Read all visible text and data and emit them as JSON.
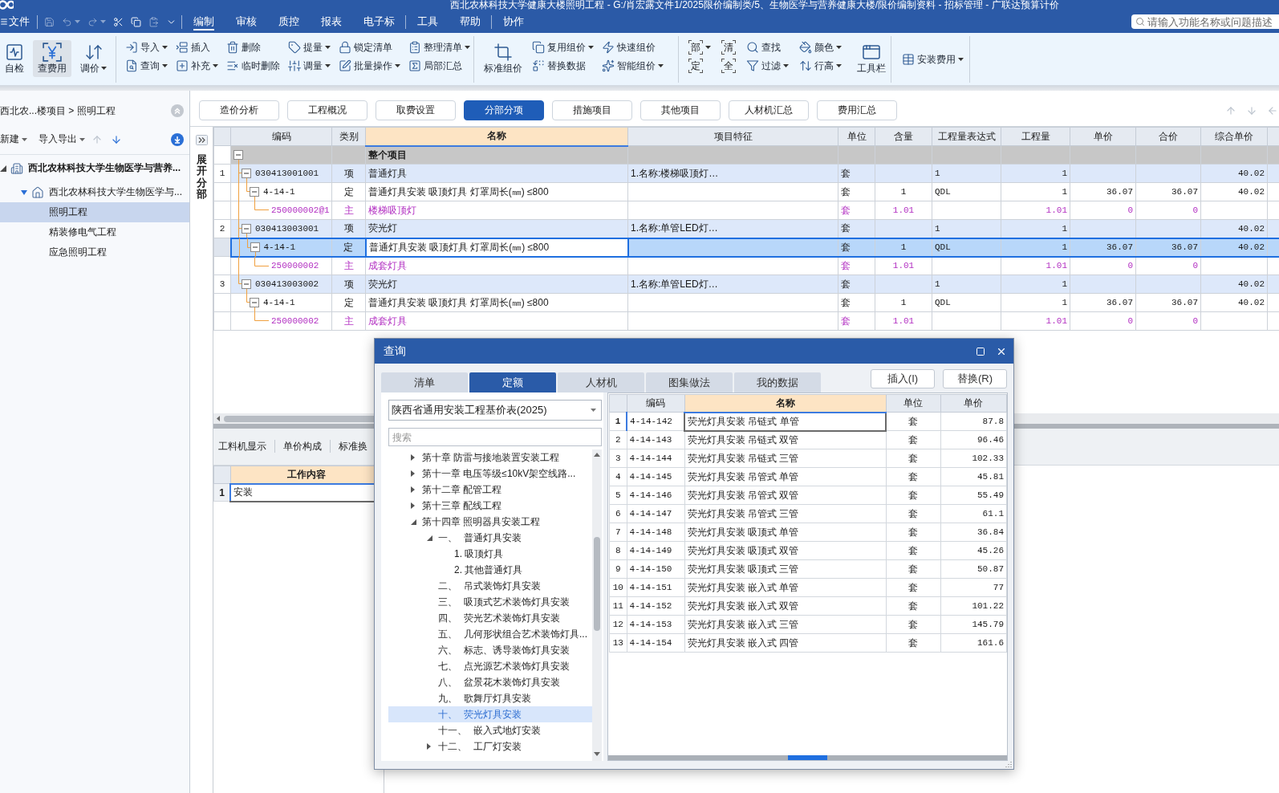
{
  "app": {
    "title": "西北农林科技大学健康大楼照明工程 - G:/肖宏露文件1/2025限价编制类/5、生物医学与营养健康大楼/限价编制资料 - 招标管理 - 广联达预算计价",
    "file_menu": "文件",
    "quick_access": [
      {
        "kind": "save",
        "disabled": true,
        "menu": false
      },
      {
        "kind": "undo",
        "disabled": true,
        "menu": true
      },
      {
        "kind": "redo",
        "disabled": true,
        "menu": true
      },
      {
        "kind": "cut",
        "disabled": false,
        "menu": false
      },
      {
        "kind": "copy",
        "disabled": false,
        "menu": false
      },
      {
        "kind": "paste",
        "disabled": true,
        "menu": false
      },
      {
        "kind": "more",
        "disabled": false,
        "menu": false
      }
    ],
    "menu_groups": [
      {
        "items": [
          {
            "label": "编制",
            "selected": true
          },
          {
            "label": "审核",
            "selected": false
          },
          {
            "label": "质控",
            "selected": false
          },
          {
            "label": "报表",
            "selected": false
          },
          {
            "label": "电子标",
            "selected": false
          }
        ]
      },
      {
        "items": [
          {
            "label": "工具",
            "selected": false
          },
          {
            "label": "帮助",
            "selected": false
          }
        ]
      },
      {
        "items": [
          {
            "label": "协作",
            "selected": false
          }
        ]
      }
    ],
    "search": {
      "placeholder": "请输入功能名称或问题描述"
    }
  },
  "ribbon": {
    "groups": [
      {
        "columns": [
          {
            "buttons": [
              {
                "label": "自检",
                "kind": "check",
                "menu": false,
                "pressed": false
              }
            ]
          },
          {
            "buttons": [
              {
                "label": "查费用",
                "kind": "yen",
                "menu": false,
                "pressed": true
              }
            ]
          },
          {
            "buttons": [
              {
                "label": "调价",
                "kind": "adjust",
                "menu": true,
                "pressed": false
              }
            ]
          }
        ]
      },
      {
        "columns": [
          {
            "buttons": [
              {
                "label": "导入",
                "kind": "import",
                "menu": true,
                "pressed": false
              },
              {
                "label": "查询",
                "kind": "query",
                "menu": true,
                "pressed": false
              }
            ]
          },
          {
            "buttons": [
              {
                "label": "插入",
                "kind": "insert",
                "menu": false,
                "pressed": false
              },
              {
                "label": "补充",
                "kind": "supplement",
                "menu": true,
                "pressed": false
              }
            ]
          },
          {
            "buttons": [
              {
                "label": "删除",
                "kind": "delete",
                "menu": false,
                "pressed": false
              },
              {
                "label": "临时删除",
                "kind": "tempdelete",
                "menu": false,
                "pressed": false
              }
            ]
          },
          {
            "buttons": [
              {
                "label": "提量",
                "kind": "extract",
                "menu": true,
                "pressed": false
              },
              {
                "label": "调量",
                "kind": "quantity",
                "menu": true,
                "pressed": false
              }
            ]
          },
          {
            "buttons": [
              {
                "label": "锁定清单",
                "kind": "lock",
                "menu": false,
                "pressed": false
              },
              {
                "label": "批量操作",
                "kind": "batch",
                "menu": true,
                "pressed": false
              }
            ]
          },
          {
            "buttons": [
              {
                "label": "整理清单",
                "kind": "organize",
                "menu": true,
                "pressed": false
              },
              {
                "label": "局部汇总",
                "kind": "subtotal",
                "menu": false,
                "pressed": false
              }
            ]
          }
        ]
      },
      {
        "columns": [
          {
            "buttons": [
              {
                "label": "标准组价",
                "kind": "standard",
                "menu": false,
                "pressed": false
              }
            ]
          },
          {
            "buttons": [
              {
                "label": "复用组价",
                "kind": "reuse",
                "menu": true,
                "pressed": false
              },
              {
                "label": "替换数据",
                "kind": "replace",
                "menu": false,
                "pressed": false
              }
            ]
          },
          {
            "buttons": [
              {
                "label": "快速组价",
                "kind": "quick",
                "menu": false,
                "pressed": false
              },
              {
                "label": "智能组价",
                "kind": "smart",
                "menu": true,
                "pressed": false
              }
            ]
          }
        ]
      },
      {
        "columns": [
          {
            "buttons": [
              {
                "label": "部",
                "kind": "bracket",
                "menu": true,
                "pressed": false
              },
              {
                "label": "定",
                "kind": "bracket",
                "menu": false,
                "pressed": false
              }
            ]
          },
          {
            "buttons": [
              {
                "label": "清",
                "kind": "bracket",
                "menu": false,
                "pressed": false
              },
              {
                "label": "全",
                "kind": "bracket",
                "menu": false,
                "pressed": false
              }
            ]
          },
          {
            "buttons": [
              {
                "label": "查找",
                "kind": "find",
                "menu": false,
                "pressed": false
              },
              {
                "label": "过滤",
                "kind": "filter",
                "menu": true,
                "pressed": false
              }
            ]
          },
          {
            "buttons": [
              {
                "label": "颜色",
                "kind": "color",
                "menu": true,
                "pressed": false
              },
              {
                "label": "行高",
                "kind": "rowheight",
                "menu": true,
                "pressed": false
              }
            ]
          },
          {
            "buttons": [
              {
                "label": "工具栏",
                "kind": "toolbar",
                "menu": false,
                "pressed": false
              }
            ]
          }
        ]
      },
      {
        "columns": [
          {
            "buttons": [
              {
                "label": "安装费用",
                "kind": "install",
                "menu": true,
                "pressed": false
              }
            ]
          }
        ]
      }
    ]
  },
  "project_panel": {
    "breadcrumb": "西北农...楼项目 > 照明工程",
    "actions": [
      {
        "label": "新建",
        "menu": true
      },
      {
        "label": "导入导出",
        "menu": true
      }
    ],
    "move_buttons": [
      {
        "kind": "up",
        "disabled": true
      },
      {
        "kind": "down",
        "disabled": false
      }
    ],
    "tree": [
      {
        "label": "西北农林科技大学生物医学与营养...",
        "kind": "project",
        "expanded": true,
        "selected": false,
        "children": [
          {
            "label": "西北农林科技大学生物医学与...",
            "kind": "building",
            "expanded": true,
            "selected": false,
            "children": [
              {
                "label": "照明工程",
                "kind": "unit",
                "selected": true
              },
              {
                "label": "精装修电气工程",
                "kind": "unit",
                "selected": false
              },
              {
                "label": "应急照明工程",
                "kind": "unit",
                "selected": false
              }
            ]
          }
        ]
      }
    ]
  },
  "main_tabs": [
    {
      "label": "造价分析",
      "selected": false
    },
    {
      "label": "工程概况",
      "selected": false
    },
    {
      "label": "取费设置",
      "selected": false
    },
    {
      "label": "分部分项",
      "selected": true
    },
    {
      "label": "措施项目",
      "selected": false
    },
    {
      "label": "其他项目",
      "selected": false
    },
    {
      "label": "人材机汇总",
      "selected": false
    },
    {
      "label": "费用汇总",
      "selected": false
    }
  ],
  "nav_buttons": [
    {
      "kind": "up",
      "disabled": true
    },
    {
      "kind": "down",
      "disabled": true
    },
    {
      "kind": "left",
      "disabled": true
    }
  ],
  "expand_strip": {
    "label": "展开分部"
  },
  "grid": {
    "columns": [
      {
        "label": "编码",
        "highlighted": false
      },
      {
        "label": "类别",
        "highlighted": false
      },
      {
        "label": "名称",
        "highlighted": true
      },
      {
        "label": "项目特征",
        "highlighted": false
      },
      {
        "label": "单位",
        "highlighted": false
      },
      {
        "label": "含量",
        "highlighted": false
      },
      {
        "label": "工程量表达式",
        "highlighted": false
      },
      {
        "label": "工程量",
        "highlighted": false
      },
      {
        "label": "单价",
        "highlighted": false
      },
      {
        "label": "合价",
        "highlighted": false
      },
      {
        "label": "综合单价",
        "highlighted": false
      }
    ],
    "rows": [
      {
        "kind": "root",
        "name": "整个项目",
        "expanded": true,
        "selected": false,
        "children": [
          {
            "kind": "item",
            "number": "1",
            "code": "030413001001",
            "type": "项",
            "name": "普通灯具",
            "feature": "1.名称:楼梯吸顶灯…",
            "unit": "套",
            "expression": "1",
            "quantity": "1",
            "composite_unit_price": "40.02",
            "expanded": true,
            "selected": false,
            "children": [
              {
                "kind": "quota",
                "code": "4-14-1",
                "type": "定",
                "name": "普通灯具安装 吸顶灯具 灯罩周长(㎜) ≤800",
                "unit": "套",
                "content": "1",
                "expression": "QDL",
                "quantity": "1",
                "unit_price": "36.07",
                "total": "36.07",
                "composite_unit_price": "40.02",
                "expanded": true,
                "selected": false,
                "children": [
                  {
                    "kind": "material",
                    "code": "250000002@1",
                    "type": "主",
                    "name": "楼梯吸顶灯",
                    "unit": "套",
                    "content": "1.01",
                    "quantity": "1.01",
                    "unit_price": "0",
                    "total": "0",
                    "selected": false
                  }
                ]
              }
            ]
          },
          {
            "kind": "item",
            "number": "2",
            "code": "030413003001",
            "type": "项",
            "name": "荧光灯",
            "feature": "1.名称:单管LED灯…",
            "unit": "套",
            "expression": "1",
            "quantity": "1",
            "composite_unit_price": "40.02",
            "expanded": true,
            "selected": false,
            "children": [
              {
                "kind": "quota",
                "code": "4-14-1",
                "type": "定",
                "name": "普通灯具安装 吸顶灯具 灯罩周长(㎜) ≤800",
                "unit": "套",
                "content": "1",
                "expression": "QDL",
                "quantity": "1",
                "unit_price": "36.07",
                "total": "36.07",
                "composite_unit_price": "40.02",
                "expanded": true,
                "selected": true,
                "children": [
                  {
                    "kind": "material",
                    "code": "250000002",
                    "type": "主",
                    "name": "成套灯具",
                    "unit": "套",
                    "content": "1.01",
                    "quantity": "1.01",
                    "unit_price": "0",
                    "total": "0",
                    "selected": false
                  }
                ]
              }
            ]
          },
          {
            "kind": "item",
            "number": "3",
            "code": "030413003002",
            "type": "项",
            "name": "荧光灯",
            "feature": "1.名称:单管LED灯…",
            "unit": "套",
            "expression": "1",
            "quantity": "1",
            "composite_unit_price": "40.02",
            "expanded": true,
            "selected": false,
            "children": [
              {
                "kind": "quota",
                "code": "4-14-1",
                "type": "定",
                "name": "普通灯具安装 吸顶灯具 灯罩周长(㎜) ≤800",
                "unit": "套",
                "content": "1",
                "expression": "QDL",
                "quantity": "1",
                "unit_price": "36.07",
                "total": "36.07",
                "composite_unit_price": "40.02",
                "expanded": true,
                "selected": false,
                "children": [
                  {
                    "kind": "material",
                    "code": "250000002",
                    "type": "主",
                    "name": "成套灯具",
                    "unit": "套",
                    "content": "1.01",
                    "quantity": "1.01",
                    "unit_price": "0",
                    "total": "0",
                    "selected": false
                  }
                ]
              }
            ]
          }
        ]
      }
    ]
  },
  "detail_panel": {
    "tabs": [
      "工料机显示",
      "单价构成",
      "标准换"
    ],
    "table": {
      "columns": [
        {
          "label": "工作内容",
          "highlighted": true
        }
      ],
      "rows": [
        {
          "number": "1",
          "content": "安装",
          "selected": true
        }
      ]
    }
  },
  "query_dialog": {
    "title": "查询",
    "tabs": [
      {
        "label": "清单",
        "selected": false
      },
      {
        "label": "定额",
        "selected": true
      },
      {
        "label": "人材机",
        "selected": false
      },
      {
        "label": "图集做法",
        "selected": false
      },
      {
        "label": "我的数据",
        "selected": false
      }
    ],
    "buttons": [
      {
        "label": "插入(I)"
      },
      {
        "label": "替换(R)"
      }
    ],
    "library": "陕西省通用安装工程基价表(2025)",
    "search": {
      "placeholder": "搜索"
    },
    "tree": [
      {
        "label": "第十章 防雷与接地装置安装工程",
        "expanded": false,
        "selected": false
      },
      {
        "label": "第十一章 电压等级≤10kV架空线路...",
        "expanded": false,
        "selected": false
      },
      {
        "label": "第十二章 配管工程",
        "expanded": false,
        "selected": false
      },
      {
        "label": "第十三章 配线工程",
        "expanded": false,
        "selected": false
      },
      {
        "label": "第十四章 照明器具安装工程",
        "expanded": true,
        "selected": false,
        "children": [
          {
            "num": "一、",
            "label": "普通灯具安装",
            "expanded": true,
            "selected": false,
            "children": [
              {
                "label": "1. 吸顶灯具",
                "selected": false
              },
              {
                "label": "2. 其他普通灯具",
                "selected": false
              }
            ]
          },
          {
            "num": "二、",
            "label": "吊式装饰灯具安装",
            "selected": false
          },
          {
            "num": "三、",
            "label": "吸顶式艺术装饰灯具安装",
            "selected": false
          },
          {
            "num": "四、",
            "label": "荧光艺术装饰灯具安装",
            "selected": false
          },
          {
            "num": "五、",
            "label": "几何形状组合艺术装饰灯具...",
            "selected": false
          },
          {
            "num": "六、",
            "label": "标志、诱导装饰灯具安装",
            "selected": false
          },
          {
            "num": "七、",
            "label": "点光源艺术装饰灯具安装",
            "selected": false
          },
          {
            "num": "八、",
            "label": "盆景花木装饰灯具安装",
            "selected": false
          },
          {
            "num": "九、",
            "label": "歌舞厅灯具安装",
            "selected": false
          },
          {
            "num": "十、",
            "label": "荧光灯具安装",
            "selected": true
          },
          {
            "num": "十一、",
            "label": "嵌入式地灯安装",
            "selected": false
          },
          {
            "num": "十二、",
            "label": "工厂灯安装",
            "expanded": false,
            "selected": false
          }
        ]
      }
    ],
    "table": {
      "columns": [
        {
          "label": "编码",
          "highlighted": false
        },
        {
          "label": "名称",
          "highlighted": true
        },
        {
          "label": "单位",
          "highlighted": false
        },
        {
          "label": "单价",
          "highlighted": false
        }
      ],
      "rows": [
        {
          "number": "1",
          "code": "4-14-142",
          "name": "荧光灯具安装 吊链式 单管",
          "unit": "套",
          "unit_price": "87.8",
          "selected": true
        },
        {
          "number": "2",
          "code": "4-14-143",
          "name": "荧光灯具安装 吊链式 双管",
          "unit": "套",
          "unit_price": "96.46",
          "selected": false
        },
        {
          "number": "3",
          "code": "4-14-144",
          "name": "荧光灯具安装 吊链式 三管",
          "unit": "套",
          "unit_price": "102.33",
          "selected": false
        },
        {
          "number": "4",
          "code": "4-14-145",
          "name": "荧光灯具安装 吊管式 单管",
          "unit": "套",
          "unit_price": "45.81",
          "selected": false
        },
        {
          "number": "5",
          "code": "4-14-146",
          "name": "荧光灯具安装 吊管式 双管",
          "unit": "套",
          "unit_price": "55.49",
          "selected": false
        },
        {
          "number": "6",
          "code": "4-14-147",
          "name": "荧光灯具安装 吊管式 三管",
          "unit": "套",
          "unit_price": "61.1",
          "selected": false
        },
        {
          "number": "7",
          "code": "4-14-148",
          "name": "荧光灯具安装 吸顶式 单管",
          "unit": "套",
          "unit_price": "36.84",
          "selected": false
        },
        {
          "number": "8",
          "code": "4-14-149",
          "name": "荧光灯具安装 吸顶式 双管",
          "unit": "套",
          "unit_price": "45.26",
          "selected": false
        },
        {
          "number": "9",
          "code": "4-14-150",
          "name": "荧光灯具安装 吸顶式 三管",
          "unit": "套",
          "unit_price": "50.87",
          "selected": false
        },
        {
          "number": "10",
          "code": "4-14-151",
          "name": "荧光灯具安装 嵌入式 单管",
          "unit": "套",
          "unit_price": "77",
          "selected": false
        },
        {
          "number": "11",
          "code": "4-14-152",
          "name": "荧光灯具安装 嵌入式 双管",
          "unit": "套",
          "unit_price": "101.22",
          "selected": false
        },
        {
          "number": "12",
          "code": "4-14-153",
          "name": "荧光灯具安装 嵌入式 三管",
          "unit": "套",
          "unit_price": "145.79",
          "selected": false
        },
        {
          "number": "13",
          "code": "4-14-154",
          "name": "荧光灯具安装 嵌入式 四管",
          "unit": "套",
          "unit_price": "161.6",
          "selected": false
        }
      ]
    }
  }
}
